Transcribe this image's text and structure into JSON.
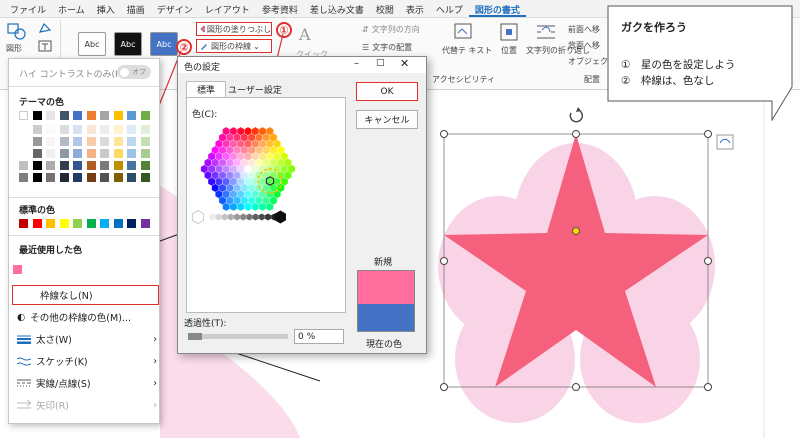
{
  "tabs": [
    "ファイル",
    "ホーム",
    "挿入",
    "描画",
    "デザイン",
    "レイアウト",
    "参考資料",
    "差し込み文書",
    "校閲",
    "表示",
    "ヘルプ",
    "図形の書式"
  ],
  "ribbon": {
    "shape_label": "図形",
    "style_buttons": [
      "Abc",
      "Abc",
      "Abc"
    ],
    "fill_label": "図形の塗りつぶし",
    "outline_label": "図形の枠線",
    "quick_label": "クイック",
    "text_direction_label": "文字列の方向",
    "text_align_label": "文字の配置",
    "alt_text_label": "代替テ キスト",
    "accessibility_label": "アクセシビリティ",
    "position_label": "位置",
    "wrap_label": "文字列の折り返し",
    "front_label": "前面へ移",
    "back_label": "背面へ移",
    "object_label": "オブジェク",
    "arrange_label": "配置",
    "marker1": "①",
    "marker2": "②"
  },
  "menu": {
    "high_contrast": "ハイ コントラストのみ(H)",
    "toggle_label": "オフ",
    "theme_title": "テーマの色",
    "standard_title": "標準の色",
    "recent_title": "最近使用した色",
    "no_outline": "枠線なし(N)",
    "more_colors": "その他の枠線の色(M)...",
    "weight": "太さ(W)",
    "sketch": "スケッチ(K)",
    "dashes": "実線/点線(S)",
    "arrows": "矢印(R)",
    "theme_colors": [
      "#ffffff",
      "#000000",
      "#e7e6e6",
      "#44546a",
      "#4472c4",
      "#ed7d31",
      "#a5a5a5",
      "#ffc000",
      "#5b9bd5",
      "#70ad47"
    ],
    "standard_colors": [
      "#c00000",
      "#ff0000",
      "#ffc000",
      "#ffff00",
      "#92d050",
      "#00b050",
      "#00b0f0",
      "#0070c0",
      "#002060",
      "#7030a0"
    ],
    "recent_colors": [
      "#ff6e9c"
    ]
  },
  "dialog": {
    "title": "色の設定",
    "tab_standard": "標準",
    "tab_custom": "ユーザー設定",
    "color_label": "色(C):",
    "ok": "OK",
    "cancel": "キャンセル",
    "new_label": "新規",
    "current_label": "現在の色",
    "transparency_label": "透過性(T):",
    "transparency_value": "0 %",
    "new_color": "#ff6e9c",
    "current_color": "#4472c4"
  },
  "callout": {
    "title": "ガクを作ろう",
    "line1": "①　星の色を設定しよう",
    "line2": "②　枠線は、色なし"
  },
  "colors": {
    "star": "#f5607d",
    "petal": "#f9cde3",
    "accent_red": "#e0302e"
  }
}
